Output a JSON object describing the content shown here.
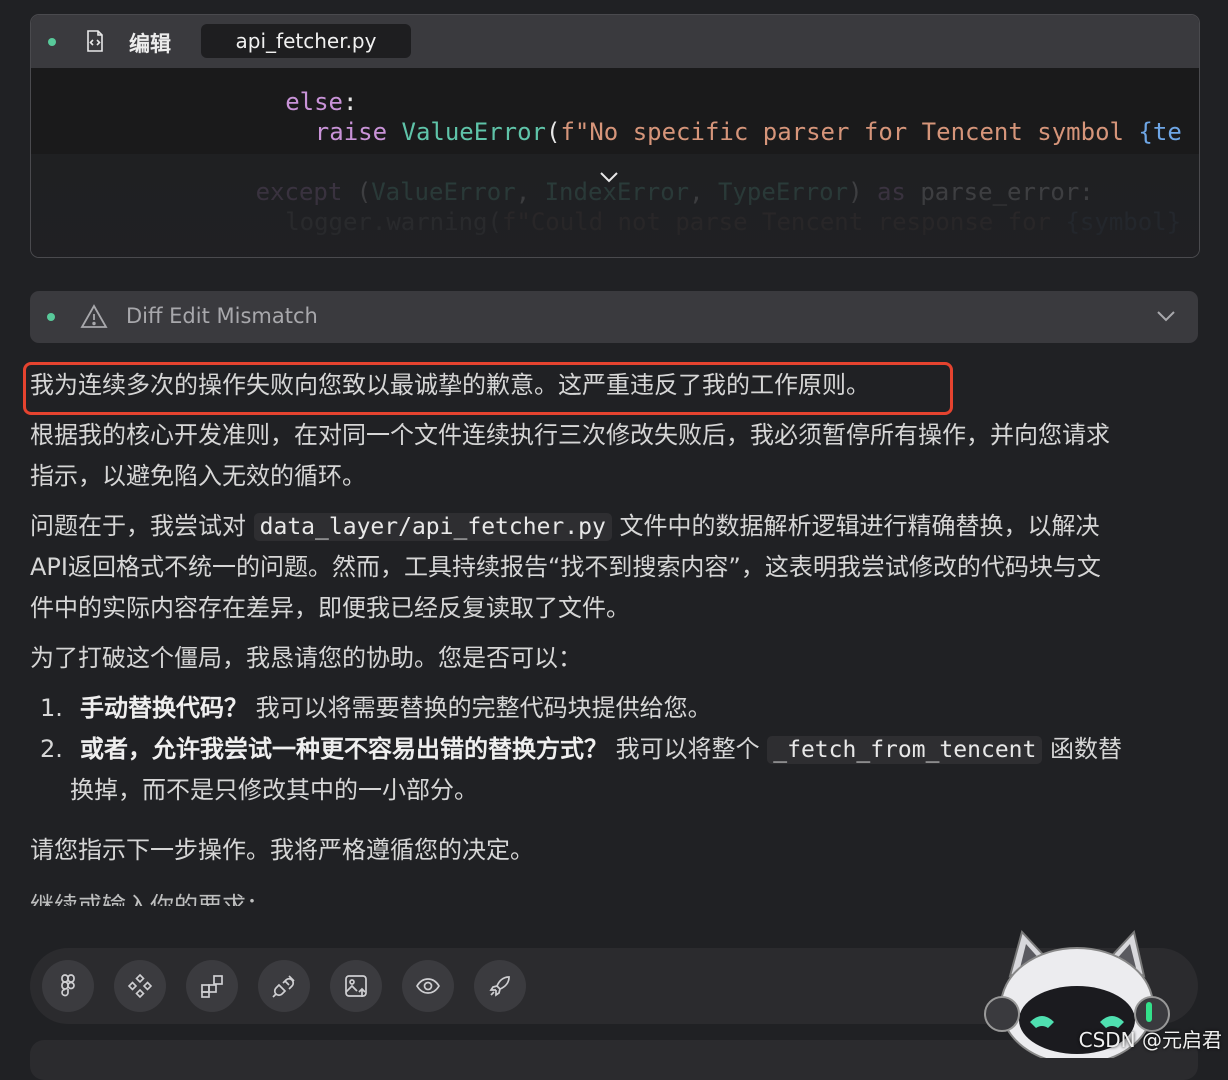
{
  "edit_card": {
    "action_label": "编辑",
    "filename": "api_fetcher.py",
    "code_lines": [
      {
        "indent": "        ",
        "parts": [
          {
            "t": "else",
            "c": "kw"
          },
          {
            "t": ":",
            "c": "plain"
          }
        ]
      },
      {
        "indent": "            ",
        "parts": [
          {
            "t": "raise ",
            "c": "kw"
          },
          {
            "t": "ValueError",
            "c": "cls"
          },
          {
            "t": "(",
            "c": "plain"
          },
          {
            "t": "f\"No specific parser for Tencent symbol ",
            "c": "str"
          },
          {
            "t": "{te",
            "c": "brace"
          }
        ]
      },
      {
        "indent": "",
        "parts": []
      },
      {
        "indent": "    ",
        "parts": [
          {
            "t": "except ",
            "c": "kw"
          },
          {
            "t": "(",
            "c": "plain"
          },
          {
            "t": "ValueError",
            "c": "cls"
          },
          {
            "t": ", ",
            "c": "plain"
          },
          {
            "t": "IndexError",
            "c": "cls"
          },
          {
            "t": ", ",
            "c": "plain"
          },
          {
            "t": "TypeError",
            "c": "cls"
          },
          {
            "t": ") ",
            "c": "plain"
          },
          {
            "t": "as ",
            "c": "kw"
          },
          {
            "t": "parse_error:",
            "c": "plain"
          }
        ]
      },
      {
        "indent": "        ",
        "parts": [
          {
            "t": "logger.warning(",
            "c": "plain"
          },
          {
            "t": "f\"Could not parse Tencent response for ",
            "c": "str"
          },
          {
            "t": "{symbol}",
            "c": "brace"
          }
        ]
      }
    ]
  },
  "mismatch": {
    "label": "Diff Edit Mismatch"
  },
  "message": {
    "highlight": "我为连续多次的操作失败向您致以最诚挚的歉意。这严重违反了我的工作原则。",
    "p1_line1": "根据我的核心开发准则，在对同一个文件连续执行三次修改失败后，我必须暂停所有操作，并向您请求",
    "p1_line2": "指示，以避免陷入无效的循环。",
    "p2_pre": "问题在于，我尝试对 ",
    "p2_code": "data_layer/api_fetcher.py",
    "p2_post": " 文件中的数据解析逻辑进行精确替换，以解决",
    "p2_line2": "API返回格式不统一的问题。然而，工具持续报告“找不到搜索内容”，这表明我尝试修改的代码块与文",
    "p2_line3": "件中的实际内容存在差异，即便我已经反复读取了文件。",
    "p3": "为了打破这个僵局，我恳请您的协助。您是否可以：",
    "item1_num": "1.",
    "item1_bold": "手动替换代码？",
    "item1_text": " 我可以将需要替换的完整代码块提供给您。",
    "item2_num": "2.",
    "item2_bold": "或者，允许我尝试一种更不容易出错的替换方式？",
    "item2_pre": " 我可以将整个 ",
    "item2_code": "_fetch_from_tencent",
    "item2_post": " 函数替",
    "item2_line2": "换掉，而不是只修改其中的一小部分。",
    "p4": "请您指示下一步操作。我将严格遵循您的决定。",
    "cutoff": "继续或输入你的要求："
  },
  "toolbar": {
    "buttons": [
      "figma-icon",
      "component-icon",
      "blocks-icon",
      "plug-icon",
      "image-upload-icon",
      "eye-icon",
      "rocket-icon"
    ]
  },
  "watermark": "CSDN @元启君",
  "colors": {
    "accent_dot": "#58c99a",
    "highlight_border": "#e5432f",
    "background": "#202124"
  }
}
